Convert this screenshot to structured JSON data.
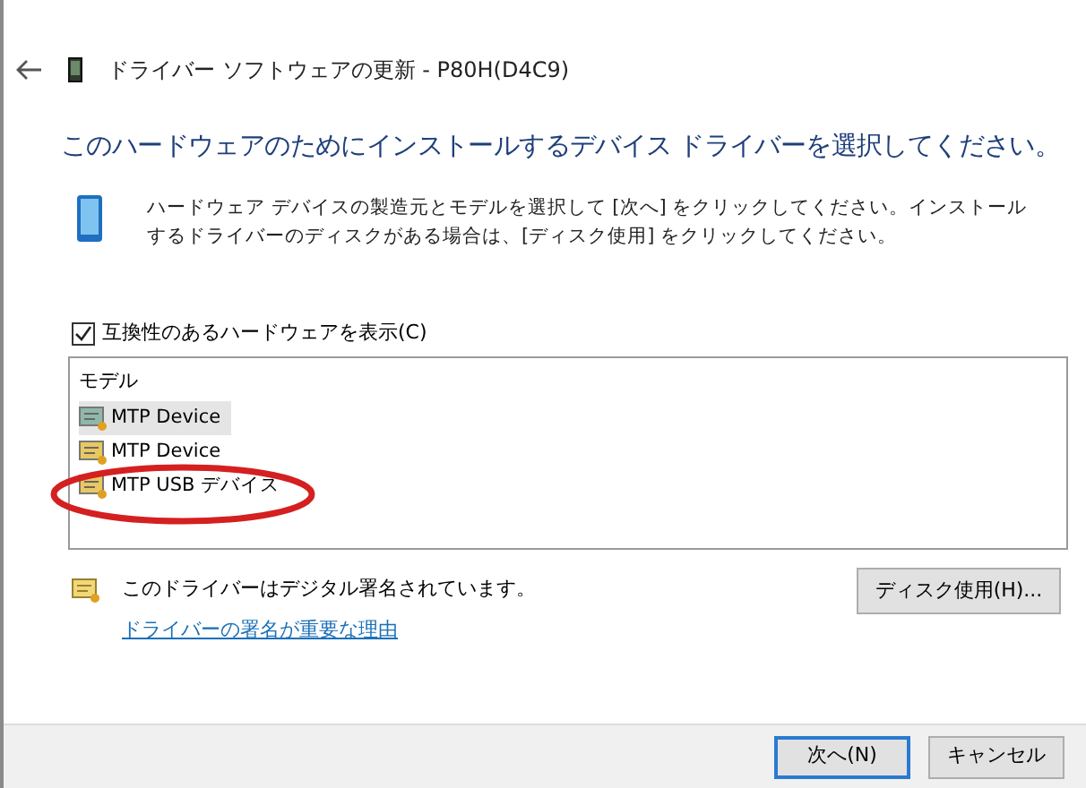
{
  "window": {
    "title": "ドライバー ソフトウェアの更新 - P80H(D4C9)"
  },
  "heading": "このハードウェアのためにインストールするデバイス ドライバーを選択してください。",
  "description": "ハードウェア デバイスの製造元とモデルを選択して [次へ] をクリックしてください。インストールするドライバーのディスクがある場合は、[ディスク使用] をクリックしてください。",
  "compatible_checkbox": {
    "label": "互換性のあるハードウェアを表示(C)",
    "checked": true
  },
  "model_list": {
    "header": "モデル",
    "items": [
      {
        "label": "MTP Device",
        "selected": true,
        "color": "#8fb8a8"
      },
      {
        "label": "MTP Device",
        "selected": false,
        "color": "#e8c860"
      },
      {
        "label": "MTP USB デバイス",
        "selected": false,
        "color": "#e8c860"
      }
    ]
  },
  "annotation": {
    "kind": "ellipse",
    "color": "#d42020"
  },
  "signature": {
    "text": "このドライバーはデジタル署名されています。",
    "link": "ドライバーの署名が重要な理由"
  },
  "disk_button": "ディスク使用(H)...",
  "buttons": [
    {
      "label": "次へ(N)",
      "default": true
    },
    {
      "label": "キャンセル",
      "default": false
    }
  ]
}
